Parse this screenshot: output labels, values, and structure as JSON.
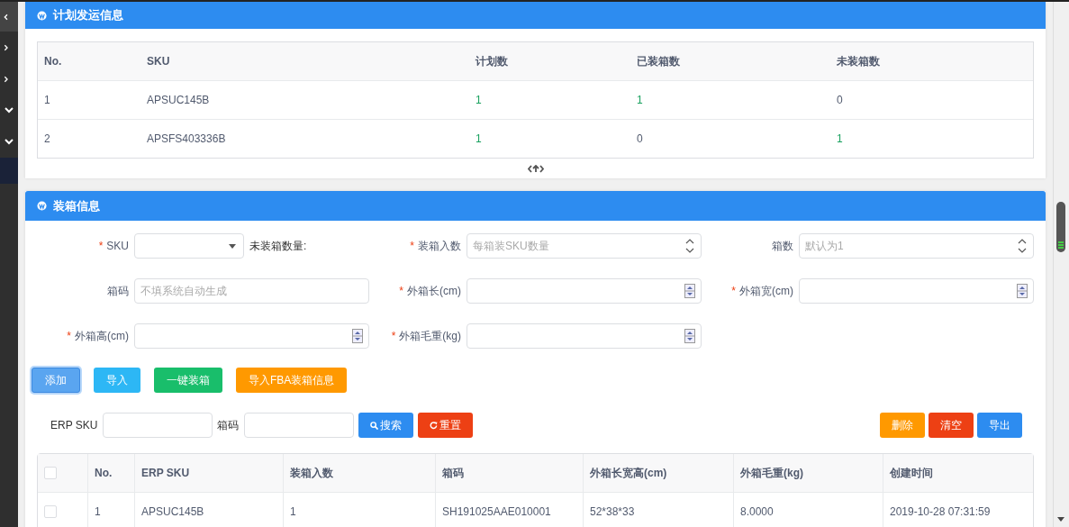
{
  "plan_panel": {
    "title": "计划发运信息",
    "table": {
      "columns": [
        "No.",
        "SKU",
        "计划数",
        "已装箱数",
        "未装箱数"
      ],
      "rows": [
        [
          {
            "text": "1",
            "highlight": false
          },
          {
            "text": "APSUC145B",
            "highlight": false
          },
          {
            "text": "1",
            "highlight": true
          },
          {
            "text": "1",
            "highlight": true
          },
          {
            "text": "0",
            "highlight": false
          }
        ],
        [
          {
            "text": "2",
            "highlight": false
          },
          {
            "text": "APSFS403336B",
            "highlight": false
          },
          {
            "text": "1",
            "highlight": true
          },
          {
            "text": "0",
            "highlight": false
          },
          {
            "text": "1",
            "highlight": true
          }
        ]
      ]
    }
  },
  "packing_panel": {
    "title": "装箱信息",
    "fields": [
      {
        "mark": "*",
        "label": "SKU",
        "kind": "select",
        "note": "未装箱数量:"
      },
      {
        "mark": "*",
        "label": "装箱入数",
        "kind": "spin",
        "placeholder": "每箱装SKU数量"
      },
      {
        "label": "箱数",
        "kind": "spin",
        "placeholder": "默认为1"
      },
      {
        "label": "箱码",
        "kind": "text",
        "placeholder": "不填系统自动生成"
      },
      {
        "mark": "*",
        "label": "外箱长(cm)",
        "kind": "number"
      },
      {
        "mark": "*",
        "label": "外箱宽(cm)",
        "kind": "number"
      },
      {
        "mark": "*",
        "label": "外箱高(cm)",
        "kind": "number"
      },
      {
        "mark": "*",
        "label": "外箱毛重(kg)",
        "kind": "number"
      }
    ],
    "actions": [
      {
        "label": "添加",
        "color": "#5aa5f0",
        "focused": true
      },
      {
        "label": "导入",
        "color": "#2db7f5",
        "focused": false
      },
      {
        "label": "一键装箱",
        "color": "#19be6b",
        "focused": false
      },
      {
        "label": "导入FBA装箱信息",
        "color": "#ff9900",
        "focused": false
      }
    ],
    "filters": [
      {
        "label": "ERP SKU"
      },
      {
        "label": "箱码"
      }
    ],
    "filter_buttons": [
      {
        "label": "搜索",
        "color": "#2d8cf0"
      },
      {
        "label": "重置",
        "color": "#ed4014"
      }
    ],
    "right_buttons": [
      {
        "label": "删除",
        "color": "#ff9900"
      },
      {
        "label": "清空",
        "color": "#ed4014"
      },
      {
        "label": "导出",
        "color": "#2d8cf0"
      }
    ],
    "table": {
      "select_all": {
        "checked": false
      },
      "columns": [
        "No.",
        "ERP SKU",
        "装箱入数",
        "箱码",
        "外箱长宽高(cm)",
        "外箱毛重(kg)",
        "创建时间"
      ],
      "rows": [
        {
          "checked": false,
          "cells": [
            "1",
            "APSUC145B",
            "1",
            "SH191025AAE010001",
            "52*38*33",
            "8.0000",
            "2019-10-28 07:31:59"
          ]
        }
      ]
    }
  }
}
